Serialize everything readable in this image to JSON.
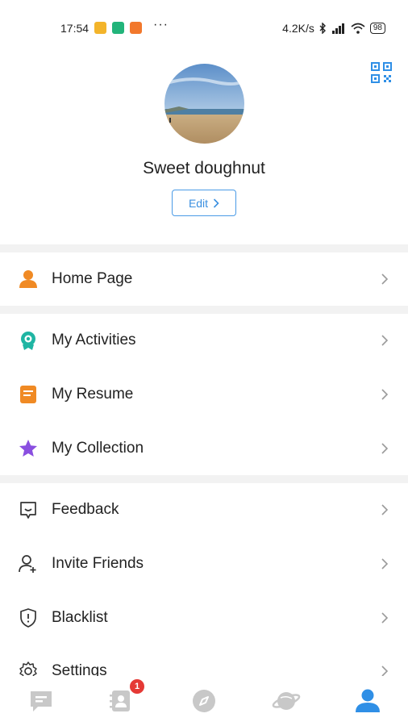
{
  "status_bar": {
    "time": "17:54",
    "dots": "···",
    "speed": "4.2K/s",
    "battery": "98"
  },
  "profile": {
    "username": "Sweet doughnut",
    "edit_label": "Edit"
  },
  "menu": {
    "home_page": "Home Page",
    "my_activities": "My Activities",
    "my_resume": "My Resume",
    "my_collection": "My Collection",
    "feedback": "Feedback",
    "invite_friends": "Invite Friends",
    "blacklist": "Blacklist",
    "settings": "Settings"
  },
  "tabbar": {
    "contacts_badge": "1",
    "active_tab": "profile"
  },
  "colors": {
    "accent": "#2f8fe6",
    "orange": "#f08a24",
    "teal": "#1fb5a3",
    "purple": "#8a4fe0",
    "badge": "#e53935",
    "inactive_icon": "#c8c8c8"
  }
}
